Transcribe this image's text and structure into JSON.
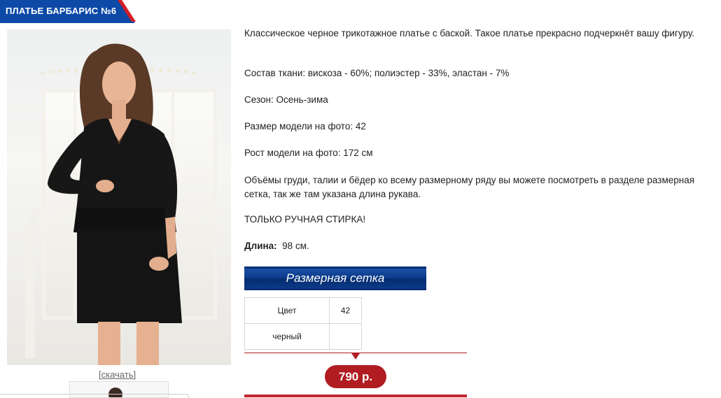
{
  "product": {
    "title": "ПЛАТЬЕ БАРБАРИС №6",
    "download_label": "[скачать]",
    "description": "Классическое черное трикотажное платье с баской. Такое платье прекрасно подчеркнёт вашу фигуру.",
    "composition": "Состав ткани: вискоза - 60%; полиэстер - 33%, эластан - 7%",
    "season": "Сезон: Осень-зима",
    "model_size": "Размер модели на фото: 42",
    "model_height": "Рост модели на фото: 172 см",
    "measurements_note": "Объёмы груди, талии и бёдер ко всему размерному ряду вы можете посмотреть в разделе размерная сетка, так же там указана длина рукава.",
    "wash_note": "ТОЛЬКО РУЧНАЯ СТИРКА!",
    "length_label": "Длина:",
    "length_value": "98 см.",
    "size_chart_button": "Размерная сетка",
    "price": "790 р."
  },
  "sizes_table": {
    "header_color": "Цвет",
    "header_size": "42",
    "row_color": "черный",
    "row_value": ""
  },
  "colors": {
    "brand_blue": "#0d4aa8",
    "brand_red": "#b01c22"
  }
}
